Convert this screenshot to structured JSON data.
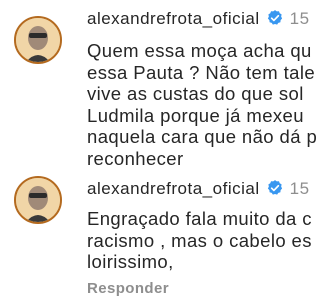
{
  "comments": [
    {
      "username": "alexandrefrota_oficial",
      "verified": true,
      "time": "15",
      "lines": [
        "Quem essa moça acha qu",
        "essa Pauta ? Não tem tale",
        "vive as custas do que sol",
        "Ludmila porque já mexeu",
        "naquela cara que não dá p",
        "reconhecer"
      ]
    },
    {
      "username": "alexandrefrota_oficial",
      "verified": true,
      "time": "15",
      "lines": [
        "Engraçado fala muito da c",
        "racismo , mas o cabelo es",
        "loirissimo,"
      ],
      "reply_label": "Responder"
    }
  ],
  "colors": {
    "verified_badge": "#3897f0",
    "muted_text": "#8e8e8e",
    "primary_text": "#262626"
  }
}
